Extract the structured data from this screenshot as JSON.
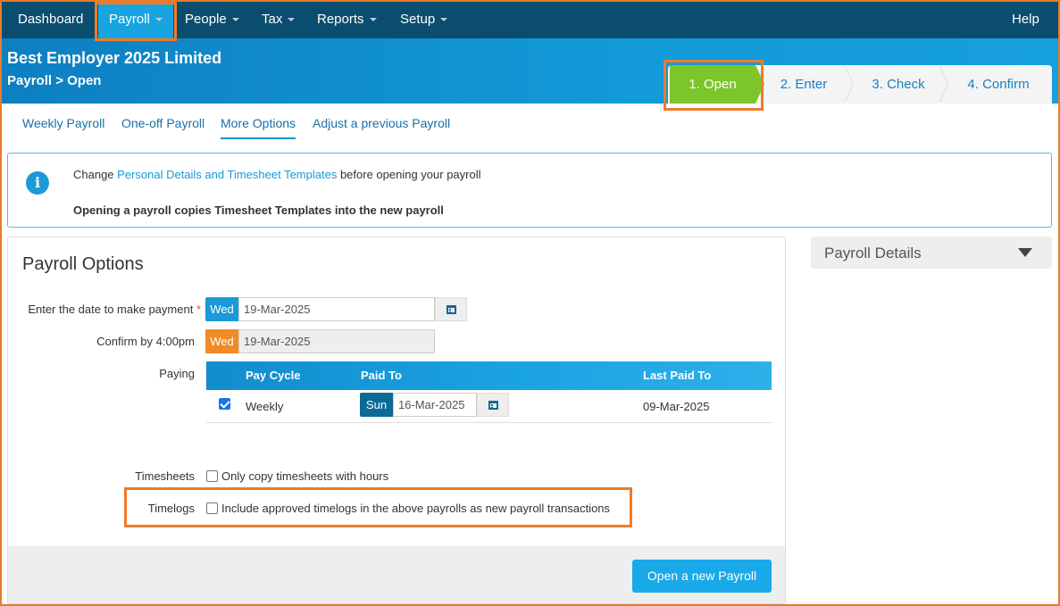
{
  "nav": {
    "items": [
      {
        "label": "Dashboard",
        "caret": false
      },
      {
        "label": "Payroll",
        "caret": true
      },
      {
        "label": "People",
        "caret": true
      },
      {
        "label": "Tax",
        "caret": true
      },
      {
        "label": "Reports",
        "caret": true
      },
      {
        "label": "Setup",
        "caret": true
      }
    ],
    "help": "Help"
  },
  "header": {
    "company": "Best Employer 2025 Limited",
    "breadcrumb": "Payroll > Open"
  },
  "steps": [
    "1. Open",
    "2. Enter",
    "3. Check",
    "4. Confirm"
  ],
  "subnav": [
    "Weekly Payroll",
    "One-off Payroll",
    "More Options",
    "Adjust a previous Payroll"
  ],
  "info": {
    "prefix": "Change ",
    "link": "Personal Details and Timesheet Templates",
    "suffix": " before opening your payroll",
    "note": "Opening a payroll copies Timesheet Templates into the new payroll"
  },
  "options": {
    "title": "Payroll Options",
    "payment_label": "Enter the date to make payment",
    "required_mark": "*",
    "payment_day": "Wed",
    "payment_date": "19-Mar-2025",
    "confirm_label": "Confirm by 4:00pm",
    "confirm_day": "Wed",
    "confirm_date": "19-Mar-2025",
    "paying_label": "Paying",
    "table": {
      "headers": {
        "cycle": "Pay Cycle",
        "paid_to": "Paid To",
        "last_paid": "Last Paid To"
      },
      "row": {
        "checked": true,
        "cycle": "Weekly",
        "day": "Sun",
        "paid_to": "16-Mar-2025",
        "last_paid": "09-Mar-2025"
      }
    },
    "timesheets_label": "Timesheets",
    "timesheets_option": "Only copy timesheets with hours",
    "timelogs_label": "Timelogs",
    "timelogs_option": "Include approved timelogs in the above payrolls as new payroll transactions",
    "open_button": "Open a new Payroll"
  },
  "details": {
    "title": "Payroll Details"
  },
  "colors": {
    "nav": "#0a4d6e",
    "accent": "#1a9ad6",
    "step_active": "#7cc52a",
    "highlight": "#f07b27"
  }
}
